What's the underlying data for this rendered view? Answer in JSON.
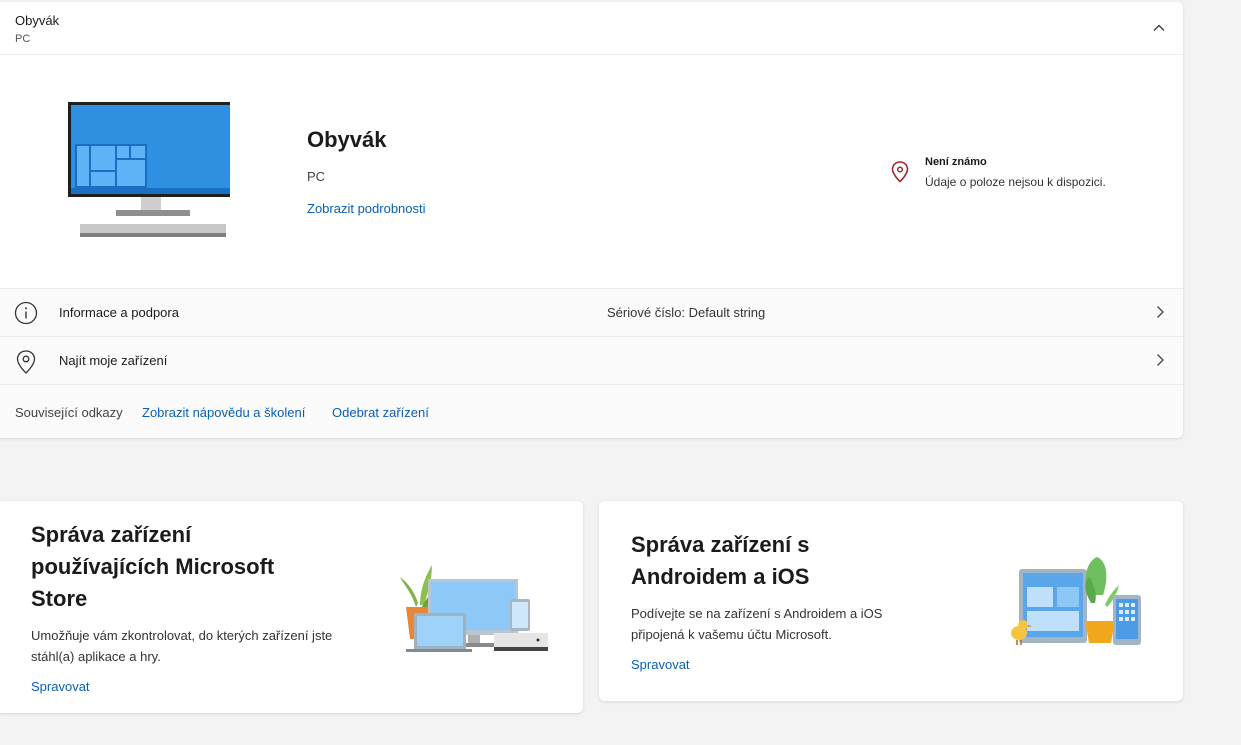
{
  "device_header": {
    "title": "Obyvák",
    "subtitle": "PC"
  },
  "device": {
    "name": "Obyvák",
    "type": "PC",
    "details_link": "Zobrazit podrobnosti",
    "location_title": "Není známo",
    "location_desc": "Údaje o poloze nejsou k dispozici."
  },
  "rows": [
    {
      "label": "Informace a podpora",
      "value": "Sériové číslo: Default string",
      "icon": "info-icon"
    },
    {
      "label": "Najít moje zařízení",
      "value": "",
      "icon": "location-pin-icon"
    }
  ],
  "related_links": {
    "label": "Související odkazy",
    "help": "Zobrazit nápovědu a školení",
    "remove": "Odebrat zařízení"
  },
  "promos": [
    {
      "title": "Správa zařízení používajících Microsoft Store",
      "desc": "Umožňuje vám zkontrolovat, do kterých zařízení jste stáhl(a) aplikace a hry.",
      "link": "Spravovat"
    },
    {
      "title": "Správa zařízení s Androidem a iOS",
      "desc": "Podívejte se na zařízení s Androidem a iOS připojená k vašemu účtu Microsoft.",
      "link": "Spravovat"
    }
  ],
  "colors": {
    "link": "#0a5fb4",
    "accent_blue": "#2b88d8",
    "location_red": "#a4262c",
    "background": "#f3f3f3"
  }
}
